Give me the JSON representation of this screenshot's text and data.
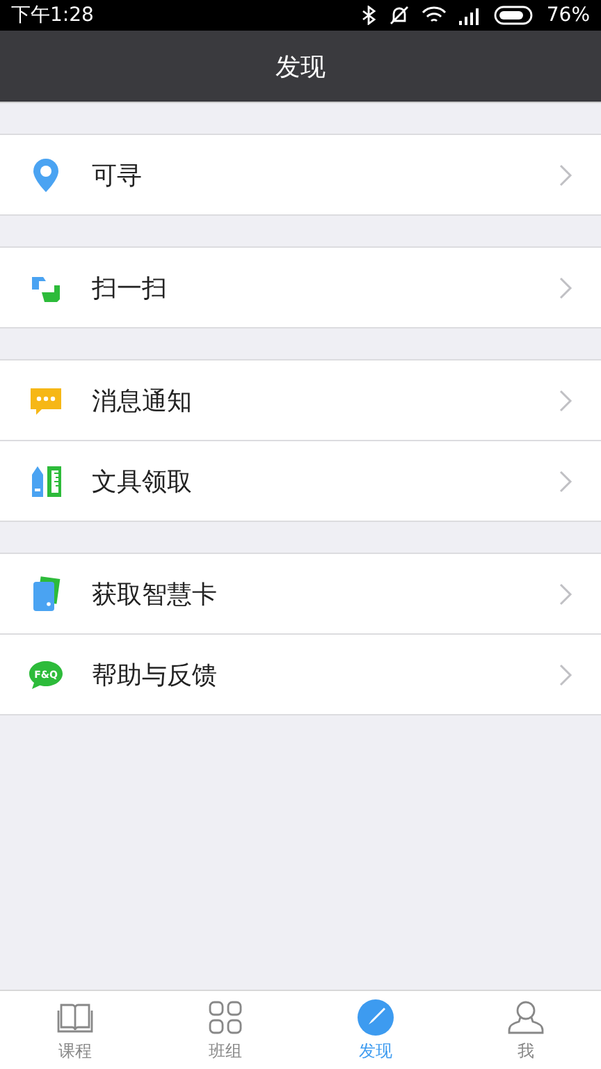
{
  "status_bar": {
    "time": "下午1:28",
    "battery_text": "76%"
  },
  "header": {
    "title": "发现"
  },
  "groups": [
    {
      "items": [
        {
          "kind": "pin",
          "label": "可寻"
        }
      ]
    },
    {
      "items": [
        {
          "kind": "scan",
          "label": "扫一扫"
        }
      ]
    },
    {
      "items": [
        {
          "kind": "message",
          "label": "消息通知"
        },
        {
          "kind": "stationery",
          "label": "文具领取"
        }
      ]
    },
    {
      "items": [
        {
          "kind": "card",
          "label": "获取智慧卡"
        },
        {
          "kind": "faq",
          "label": "帮助与反馈",
          "icon_text": "F&Q"
        }
      ]
    }
  ],
  "tabs": [
    {
      "kind": "book",
      "label": "课程",
      "selected": false
    },
    {
      "kind": "grid",
      "label": "班组",
      "selected": false
    },
    {
      "kind": "compass",
      "label": "发现",
      "selected": true
    },
    {
      "kind": "person",
      "label": "我",
      "selected": false
    }
  ]
}
